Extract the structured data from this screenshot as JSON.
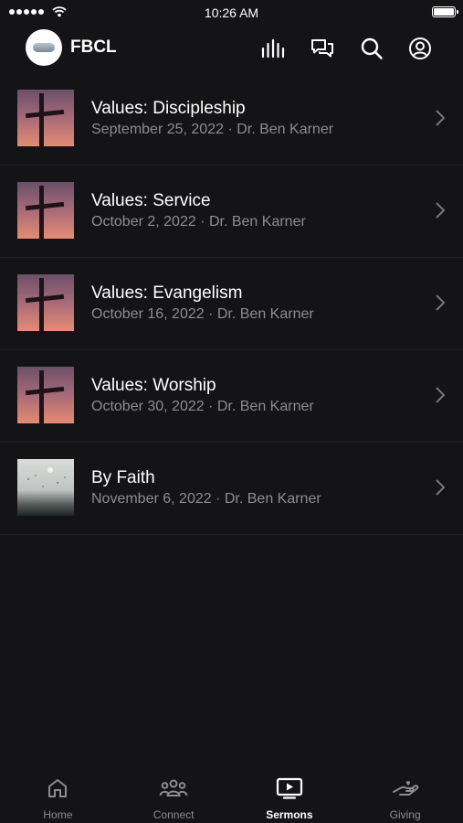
{
  "status_bar": {
    "time": "10:26 AM"
  },
  "header": {
    "app_name": "FBCL"
  },
  "sermons": [
    {
      "title": "Values: Discipleship",
      "subtitle": "September 25, 2022 · Dr. Ben Karner",
      "thumbnail": "cross-sunset"
    },
    {
      "title": "Values: Service",
      "subtitle": "October 2, 2022 · Dr. Ben Karner",
      "thumbnail": "cross-sunset"
    },
    {
      "title": "Values: Evangelism",
      "subtitle": "October 16, 2022 · Dr. Ben Karner",
      "thumbnail": "cross-sunset"
    },
    {
      "title": "Values: Worship",
      "subtitle": "October 30, 2022 · Dr. Ben Karner",
      "thumbnail": "cross-sunset"
    },
    {
      "title": "By Faith",
      "subtitle": "November 6, 2022 · Dr. Ben Karner",
      "thumbnail": "misty-landscape"
    }
  ],
  "tabs": [
    {
      "label": "Home",
      "icon": "home-icon",
      "active": false
    },
    {
      "label": "Connect",
      "icon": "people-icon",
      "active": false
    },
    {
      "label": "Sermons",
      "icon": "play-screen-icon",
      "active": true
    },
    {
      "label": "Giving",
      "icon": "giving-hand-icon",
      "active": false
    }
  ],
  "colors": {
    "background": "#141416",
    "text_primary": "#ffffff",
    "text_secondary": "#8c8c92",
    "divider": "#232326"
  }
}
